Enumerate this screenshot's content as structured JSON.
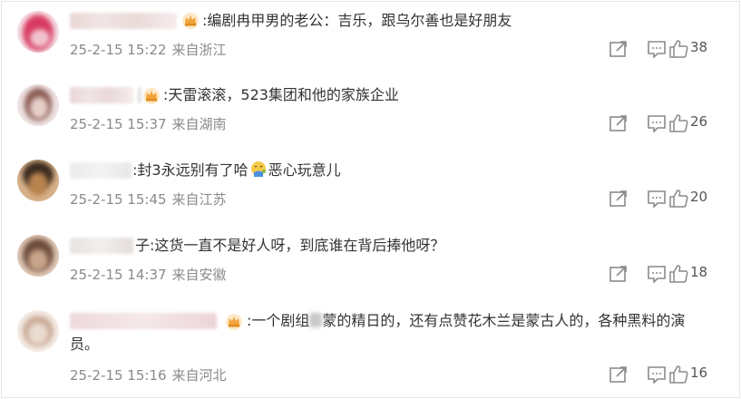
{
  "comments": [
    {
      "text": ":编剧冉甲男的老公：吉乐，跟乌尔善也是好朋友",
      "date": "25-2-15 15:22",
      "location": "来自浙江",
      "likes": "38",
      "colors": {
        "avatar_a": "#f0c4cf",
        "avatar_b": "#d83a62",
        "avatar_c": "#f7e1e6"
      }
    },
    {
      "text": ":天雷滚滚，523集团和他的家族企业",
      "date": "25-2-15 15:37",
      "location": "来自湖南",
      "likes": "26",
      "colors": {
        "avatar_a": "#e7cfc9",
        "avatar_b": "#8a5a52",
        "avatar_c": "#efe2e2"
      }
    },
    {
      "text_before": ":封3永远别有了哈",
      "text_after": "恶心玩意儿",
      "date": "25-2-15 15:45",
      "location": "来自江苏",
      "likes": "20",
      "colors": {
        "avatar_a": "#b8844e",
        "avatar_b": "#3a2a1f",
        "avatar_c": "#d7b18a"
      }
    },
    {
      "text": "子:这货一直不是好人呀，到底谁在背后捧他呀？",
      "date": "25-2-15 14:37",
      "location": "来自安徽",
      "likes": "18",
      "colors": {
        "avatar_a": "#c8a48b",
        "avatar_b": "#6b4a3a",
        "avatar_c": "#e0c8b6"
      }
    },
    {
      "text_before": ":一个剧组",
      "text_after": "蒙的精日的，还有点赞花木兰是蒙古人的，各种黑料的演",
      "text_line2": "员。",
      "date": "25-2-15 15:16",
      "location": "来自河北",
      "likes": "16",
      "colors": {
        "avatar_a": "#eadbd0",
        "avatar_b": "#c9a994",
        "avatar_c": "#f5ece6"
      }
    }
  ],
  "icons": {
    "share": "share-icon",
    "comment": "comment-icon",
    "like": "thumbs-up-icon",
    "crown": "crown-badge-icon",
    "emoji": "nauseated-emoji-icon"
  },
  "theme": {
    "text": "#333333",
    "meta": "#8a8a8a",
    "icon": "#8a8a8a",
    "border": "#e6e6e6",
    "crown": "#f2a23a"
  }
}
